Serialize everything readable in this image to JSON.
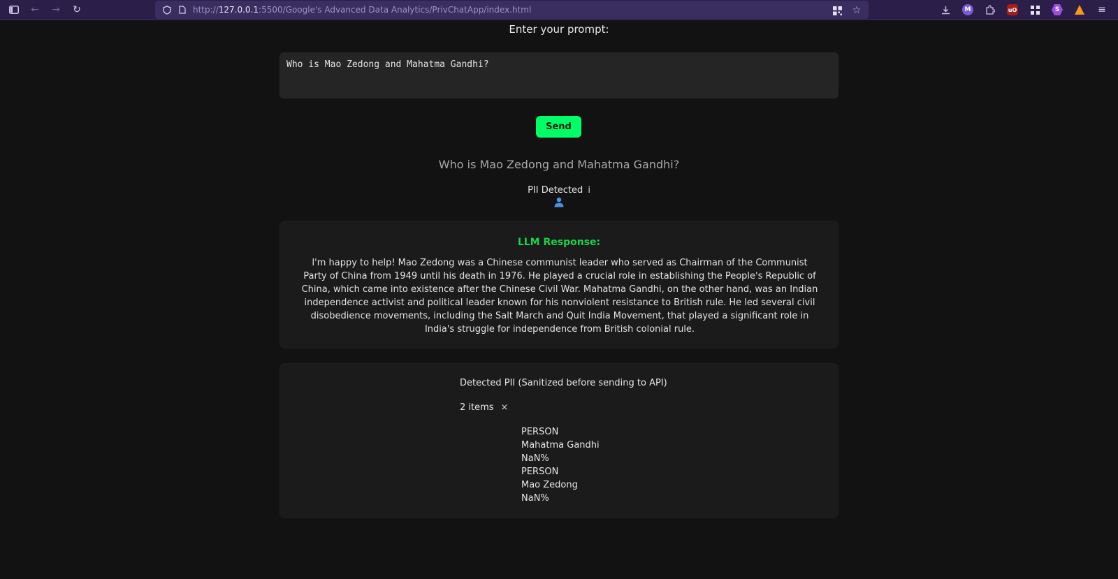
{
  "browser": {
    "url_prefix": "http://",
    "url_host": "127.0.0.1",
    "url_rest": ":5500/Google's Advanced Data Analytics/PrivChatApp/index.html"
  },
  "page": {
    "prompt_label": "Enter your prompt:",
    "prompt_value": "Who is Mao Zedong and Mahatma Gandhi?",
    "send_label": "Send",
    "echo_text": "Who is Mao Zedong and Mahatma Gandhi?",
    "pii_flag": "PII Detected",
    "pii_flag_info": "i",
    "response": {
      "title": "LLM Response:",
      "text": "I'm happy to help! Mao Zedong was a Chinese communist leader who served as Chairman of the Communist Party of China from 1949 until his death in 1976. He played a crucial role in establishing the People's Republic of China, which came into existence after the Chinese Civil War. Mahatma Gandhi, on the other hand, was an Indian independence activist and political leader known for his nonviolent resistance to British rule. He led several civil disobedience movements, including the Salt March and Quit India Movement, that played a significant role in India's struggle for independence from British colonial rule."
    },
    "pii_panel": {
      "title": "Detected PII (Sanitized before sending to API)",
      "count": "2 items",
      "close": "×",
      "items": [
        {
          "type": "PERSON",
          "value": "Mahatma Gandhi",
          "score": "NaN%"
        },
        {
          "type": "PERSON",
          "value": "Mao Zedong",
          "score": "NaN%"
        }
      ]
    }
  },
  "colors": {
    "accent": "#00ff66",
    "response_title": "#19d44a",
    "toolbar": "#2b1f4a"
  }
}
